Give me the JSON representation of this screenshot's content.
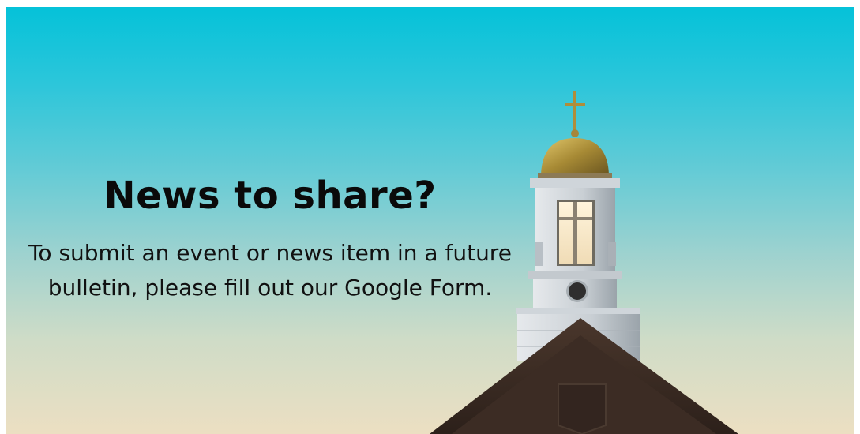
{
  "banner": {
    "headline": "News to share?",
    "body": "To submit an event or news item in a future bulletin, please fill out our Google Form."
  },
  "colors": {
    "sky_top": "#05c2d9",
    "sky_bottom": "#ecdfc2",
    "text": "#0a0a0a",
    "dome": "#b89a3e",
    "tower": "#d9dde0",
    "roof": "#3a2a22"
  },
  "icons": {
    "cross": "cross-icon"
  }
}
